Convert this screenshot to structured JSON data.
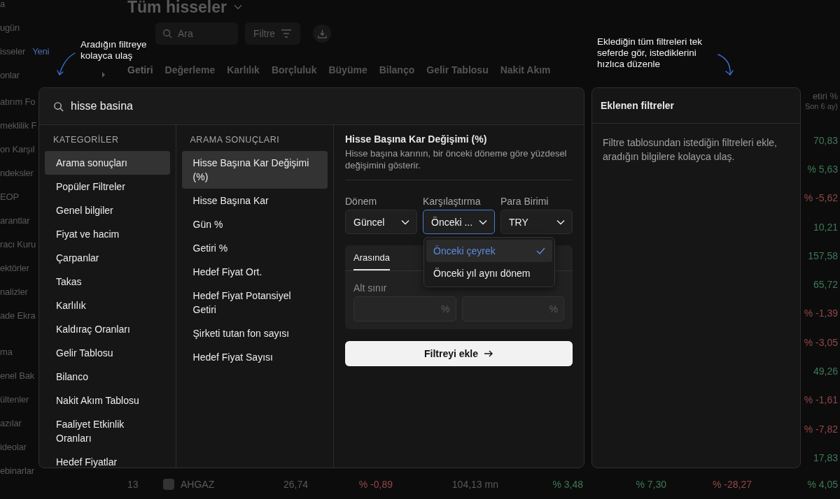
{
  "background": {
    "sidebar_groups": [
      {
        "items": [
          {
            "label": "a",
            "kind": "link"
          },
          {
            "label": "ugün",
            "kind": "link"
          },
          {
            "label": "isseler",
            "kind": "link",
            "badge": "Yeni"
          },
          {
            "label": "onlar",
            "kind": "group"
          }
        ]
      },
      {
        "items": [
          {
            "label": "atırım Fo",
            "kind": "link"
          },
          {
            "label": "meklilik F",
            "kind": "link"
          },
          {
            "label": "on Karşıl",
            "kind": "link"
          },
          {
            "label": "ndeksler",
            "kind": "link"
          },
          {
            "label": "EOP",
            "kind": "link"
          },
          {
            "label": "arantlar",
            "kind": "link"
          },
          {
            "label": "racı Kuru",
            "kind": "link"
          },
          {
            "label": "ektörler",
            "kind": "link"
          },
          {
            "label": "nalizler",
            "kind": "link"
          },
          {
            "label": "ade Ekra",
            "kind": "link"
          }
        ]
      },
      {
        "items": [
          {
            "label": "ma",
            "kind": "link"
          },
          {
            "label": "enel Bak",
            "kind": "link"
          },
          {
            "label": "ültenler",
            "kind": "link"
          },
          {
            "label": "azılar",
            "kind": "link"
          },
          {
            "label": "ideolar",
            "kind": "link"
          },
          {
            "label": "ebinarlar",
            "kind": "link"
          }
        ]
      }
    ],
    "title": "Tüm hisseler",
    "search": {
      "placeholder": "Ara"
    },
    "filter_button": "Filtre",
    "tabs": [
      "Getiri",
      "Değerleme",
      "Karlılık",
      "Borçluluk",
      "Büyüme",
      "Bilanço",
      "Gelir Tablosu",
      "Nakit Akım"
    ],
    "column_header": {
      "title": "etiri %",
      "subtitle": "Son 6 ay)"
    },
    "column_values": [
      {
        "text": "70,83",
        "color": "#3f7a57"
      },
      {
        "text": "% 5,63",
        "color": "#3f7a57"
      },
      {
        "text": "% -5,62",
        "color": "#94474a"
      },
      {
        "text": "10,21",
        "color": "#3f7a57"
      },
      {
        "text": "157,58",
        "color": "#3f7a57"
      },
      {
        "text": "65,72",
        "color": "#3f7a57"
      },
      {
        "text": "% -1,39",
        "color": "#94474a"
      },
      {
        "text": "% -3,05",
        "color": "#94474a"
      },
      {
        "text": "49,26",
        "color": "#3f7a57"
      },
      {
        "text": "% -1,61",
        "color": "#94474a"
      },
      {
        "text": "% -7,82",
        "color": "#94474a"
      },
      {
        "text": "17,83",
        "color": "#3f7a57"
      }
    ],
    "last_row": {
      "rank": "13",
      "symbol": "AHGAZ",
      "cells": [
        {
          "text": "26,74",
          "color": "#5a5a5a"
        },
        {
          "text": "% -0,89",
          "color": "#94474a"
        },
        {
          "text": "104,13 mn",
          "color": "#5a5a5a"
        },
        {
          "text": "% 3,48",
          "color": "#3f7a57"
        },
        {
          "text": "% 7,30",
          "color": "#3f7a57"
        },
        {
          "text": "% -28,27",
          "color": "#94474a"
        },
        {
          "text": "% 4,05",
          "color": "#3f7a57"
        }
      ]
    }
  },
  "hints": [
    "Aradığın filtreye kolayca ulaş",
    "Eklediğin tüm filtreleri tek seferde gör, istediklerini hızlıca düzenle"
  ],
  "search": {
    "value": "hisse basina"
  },
  "categories": {
    "heading": "KATEGORİLER",
    "items": [
      {
        "label": "Arama sonuçları",
        "selected": true
      },
      {
        "label": "Popüler Filtreler",
        "selected": false
      },
      {
        "label": "Genel bilgiler",
        "selected": false
      },
      {
        "label": "Fiyat ve hacim",
        "selected": false
      },
      {
        "label": "Çarpanlar",
        "selected": false
      },
      {
        "label": "Takas",
        "selected": false
      },
      {
        "label": "Karlılık",
        "selected": false
      },
      {
        "label": "Kaldıraç Oranları",
        "selected": false
      },
      {
        "label": "Gelir Tablosu",
        "selected": false
      },
      {
        "label": "Bilanco",
        "selected": false
      },
      {
        "label": "Nakit Akım Tablosu",
        "selected": false
      },
      {
        "label": "Faaliyet Etkinlik Oranları",
        "selected": false
      },
      {
        "label": "Hedef Fiyatlar",
        "selected": false
      }
    ]
  },
  "results": {
    "heading": "ARAMA SONUÇLARI",
    "items": [
      {
        "label": "Hisse Başına Kar Değişimi (%)",
        "selected": true
      },
      {
        "label": "Hisse Başına Kar",
        "selected": false
      },
      {
        "label": "Gün %",
        "selected": false
      },
      {
        "label": "Getiri %",
        "selected": false
      },
      {
        "label": "Hedef Fiyat Ort.",
        "selected": false
      },
      {
        "label": "Hedef Fiyat Potansiyel Getiri",
        "selected": false
      },
      {
        "label": "Şirketi tutan fon sayısı",
        "selected": false
      },
      {
        "label": "Hedef Fiyat Sayısı",
        "selected": false
      }
    ]
  },
  "detail": {
    "title": "Hisse Başına Kar Değişimi (%)",
    "description": "Hisse başına karının, bir önceki döneme göre yüzdesel değişimini gösterir.",
    "selects": [
      {
        "label": "Dönem",
        "value": "Güncel",
        "focused": false
      },
      {
        "label": "Karşılaştırma",
        "value": "Önceki ...",
        "focused": true
      },
      {
        "label": "Para Birimi",
        "value": "TRY",
        "focused": false
      }
    ],
    "dropdown": {
      "options": [
        {
          "label": "Önceki çeyrek",
          "selected": true
        },
        {
          "label": "Önceki yıl aynı dönem",
          "selected": false
        }
      ]
    },
    "range": {
      "tabs": [
        {
          "label": "Arasında",
          "selected": true
        }
      ],
      "fields": [
        {
          "label": "Alt sınır",
          "unit": "%"
        },
        {
          "unit": "%"
        }
      ]
    },
    "add_button": "Filtreyi ekle"
  },
  "added_panel": {
    "title": "Eklenen filtreler",
    "empty_text": "Filtre tablosundan istediğin filtreleri ekle, aradığın bilgilere kolayca ulaş."
  }
}
